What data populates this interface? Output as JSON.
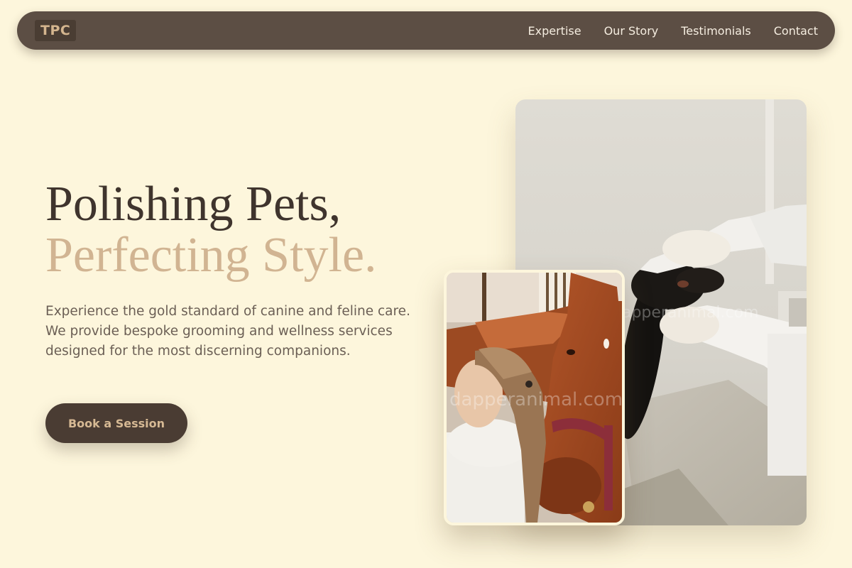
{
  "brand": {
    "logo": "TPC",
    "accent_color": "#d1b492",
    "dark_color": "#4a3c33",
    "background_color": "#fdf6dc"
  },
  "nav": {
    "links": [
      "Expertise",
      "Our Story",
      "Testimonials",
      "Contact"
    ]
  },
  "hero": {
    "title_line1": "Polishing Pets,",
    "title_line2": "Perfecting Style.",
    "description": "Experience the gold standard of canine and feline care. We provide bespoke grooming and wellness services designed for the most discerning companions.",
    "cta_label": "Book a Session"
  },
  "images": {
    "main_watermark": "dapperanimal.com",
    "inset_watermark": "dapperanimal.com"
  }
}
